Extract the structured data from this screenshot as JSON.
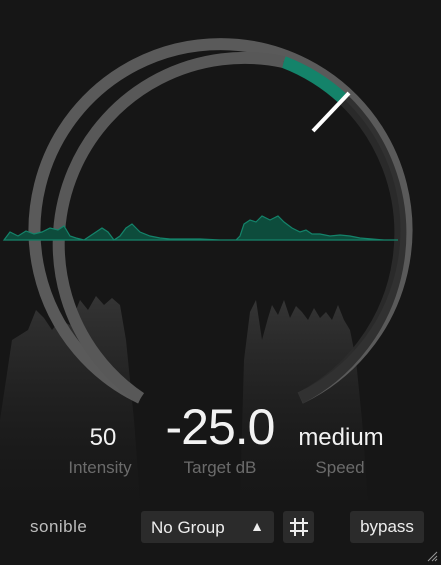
{
  "controls": {
    "intensity": {
      "value": "50",
      "label": "Intensity"
    },
    "target": {
      "value": "-25.0",
      "label": "Target dB"
    },
    "speed": {
      "value": "medium",
      "label": "Speed"
    }
  },
  "footer": {
    "brand": "sonible",
    "group": {
      "selected": "No Group",
      "arrow": "▲"
    },
    "grid_icon": "grid-icon",
    "bypass_label": "bypass"
  },
  "colors": {
    "background": "#161616",
    "ring": "#5a5a5a",
    "ring_dark": "#2a2a2a",
    "accent": "#14836a",
    "needle": "#ffffff"
  }
}
